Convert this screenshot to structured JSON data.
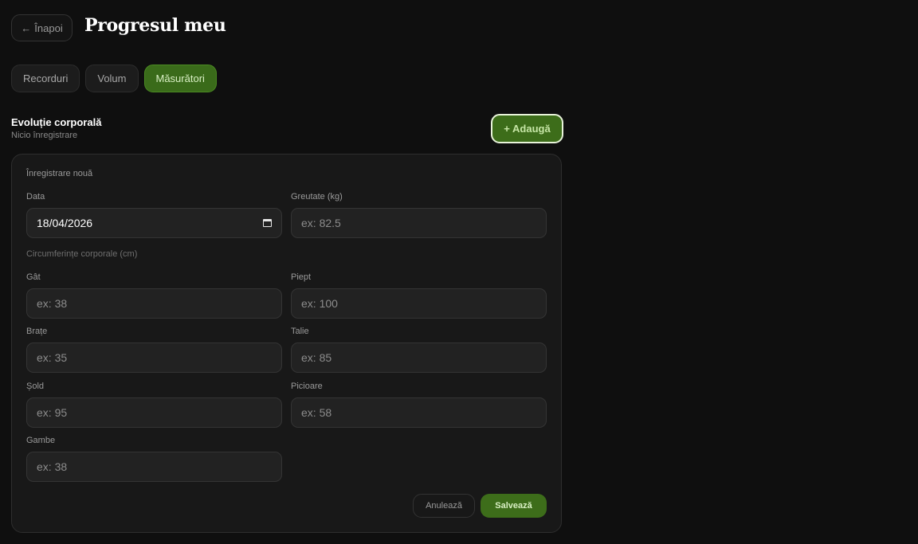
{
  "header": {
    "back_label": "Înapoi",
    "back_arrow": "←",
    "title": "Progresul meu"
  },
  "tabs": [
    {
      "label": "Recorduri",
      "active": false
    },
    {
      "label": "Volum",
      "active": false
    },
    {
      "label": "Măsurători",
      "active": true
    }
  ],
  "section": {
    "title": "Evoluție corporală",
    "subtitle": "Nicio înregistrare",
    "add_label": "+ Adaugă"
  },
  "form": {
    "title": "Înregistrare nouă",
    "date": {
      "label": "Data",
      "value": "18/04/2026"
    },
    "weight": {
      "label": "Greutate (kg)",
      "placeholder": "ex: 82.5"
    },
    "circumferences_label": "Circumferințe corporale (cm)",
    "neck": {
      "label": "Gât",
      "placeholder": "ex: 38"
    },
    "chest": {
      "label": "Piept",
      "placeholder": "ex: 100"
    },
    "arms": {
      "label": "Brațe",
      "placeholder": "ex: 35"
    },
    "waist": {
      "label": "Talie",
      "placeholder": "ex: 85"
    },
    "hips": {
      "label": "Șold",
      "placeholder": "ex: 95"
    },
    "legs": {
      "label": "Picioare",
      "placeholder": "ex: 58"
    },
    "calves": {
      "label": "Gambe",
      "placeholder": "ex: 38"
    },
    "cancel_label": "Anulează",
    "save_label": "Salvează"
  },
  "colors": {
    "accent": "#3d6d1a",
    "background": "#0f0f0f",
    "card": "#181818"
  }
}
